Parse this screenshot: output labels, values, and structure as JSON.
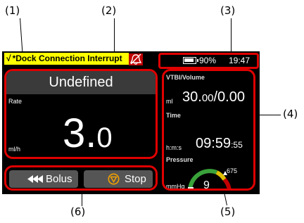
{
  "callouts": {
    "c1": "(1)",
    "c2": "(2)",
    "c3": "(3)",
    "c4": "(4)",
    "c5": "(5)",
    "c6": "(6)"
  },
  "alarm": {
    "check": "√",
    "text": "*Dock Connection Interrupt",
    "background_color": "#ffff00",
    "icon": "alarm-bell-off-icon"
  },
  "status": {
    "battery_icon": "battery-icon",
    "battery_percent": "90%",
    "time": "19:47"
  },
  "infusion": {
    "drug_name": "Undefined",
    "rate_label": "Rate",
    "rate_unit": "ml/h",
    "rate_int": "3.",
    "rate_dec": "0"
  },
  "buttons": {
    "bolus_icon": "fast-rewind-icon",
    "bolus_label": "Bolus",
    "stop_icon": "stop-icon",
    "stop_label": "Stop"
  },
  "params": {
    "vtbi_title": "VTBI/Volume",
    "vtbi_unit": "ml",
    "vtbi_first": "30.",
    "vtbi_first_dec": "00",
    "vtbi_rest": "/0.00",
    "time_title": "Time",
    "time_unit": "h:m:s",
    "time_main": "09:59",
    "time_sec": ":55",
    "pressure_title": "Pressure",
    "pressure_unit": "mmHg",
    "pressure_max": "675",
    "pressure_value": "9",
    "pressure_level": 0.02
  },
  "colors": {
    "highlight_border": "#e00000",
    "gauge_green": "#3aa23a",
    "gauge_yellow": "#e0c000",
    "gauge_red": "#c00000"
  }
}
